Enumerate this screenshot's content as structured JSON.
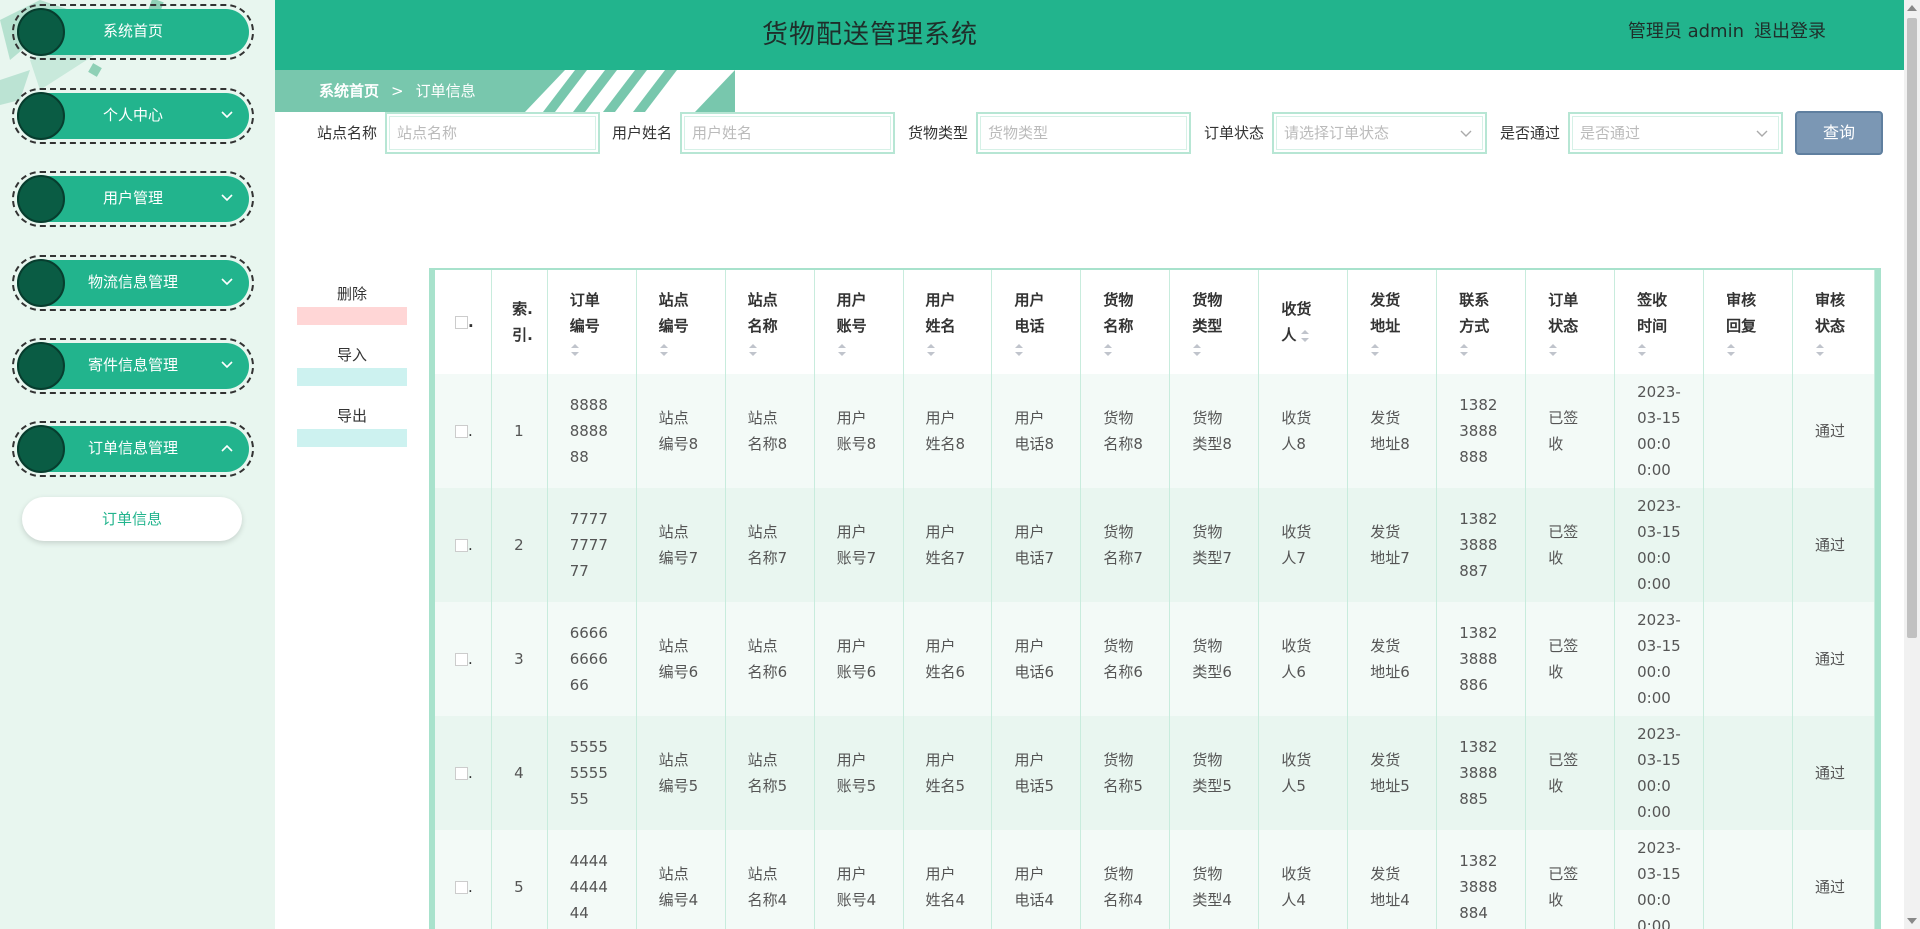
{
  "header": {
    "title": "货物配送管理系统",
    "user_label": "管理员 admin",
    "logout_label": "退出登录"
  },
  "sidebar": {
    "items": [
      {
        "label": "系统首页",
        "has_chevron": false
      },
      {
        "label": "个人中心",
        "has_chevron": true,
        "chevron": "chevron-down-icon"
      },
      {
        "label": "用户管理",
        "has_chevron": true,
        "chevron": "chevron-down-icon"
      },
      {
        "label": "物流信息管理",
        "has_chevron": true,
        "chevron": "chevron-down-icon"
      },
      {
        "label": "寄件信息管理",
        "has_chevron": true,
        "chevron": "chevron-down-icon"
      },
      {
        "label": "订单信息管理",
        "has_chevron": true,
        "chevron": "chevron-up-icon"
      }
    ],
    "sub_item": "订单信息"
  },
  "breadcrumb": {
    "home": "系统首页",
    "separator": ">",
    "current": "订单信息"
  },
  "search": {
    "fields": [
      {
        "label": "站点名称",
        "placeholder": "站点名称"
      },
      {
        "label": "用户姓名",
        "placeholder": "用户姓名"
      },
      {
        "label": "货物类型",
        "placeholder": "货物类型"
      },
      {
        "label": "订单状态",
        "placeholder": "请选择订单状态"
      },
      {
        "label": "是否通过",
        "placeholder": "是否通过"
      }
    ],
    "button": "查询"
  },
  "actions": {
    "delete": "删除",
    "import": "导入",
    "export": "导出"
  },
  "table": {
    "headers": [
      [
        "索.",
        "引."
      ],
      [
        "订单",
        "编号"
      ],
      [
        "站点",
        "编号"
      ],
      [
        "站点",
        "名称"
      ],
      [
        "用户",
        "账号"
      ],
      [
        "用户",
        "姓名"
      ],
      [
        "用户",
        "电话"
      ],
      [
        "货物",
        "名称"
      ],
      [
        "货物",
        "类型"
      ],
      [
        "收货",
        "人"
      ],
      [
        "发货",
        "地址"
      ],
      [
        "联系",
        "方式"
      ],
      [
        "订单",
        "状态"
      ],
      [
        "签收",
        "时间"
      ],
      [
        "审核",
        "回复"
      ],
      [
        "审核",
        "状态"
      ]
    ],
    "rows": [
      {
        "index": "1",
        "order_no": [
          "8888",
          "8888",
          "88"
        ],
        "site_no": [
          "站点",
          "编号8"
        ],
        "site_name": [
          "站点",
          "名称8"
        ],
        "account": [
          "用户",
          "账号8"
        ],
        "name": [
          "用户",
          "姓名8"
        ],
        "phone": [
          "用户",
          "电话8"
        ],
        "goods_name": [
          "货物",
          "名称8"
        ],
        "goods_type": [
          "货物",
          "类型8"
        ],
        "receiver": [
          "收货",
          "人8"
        ],
        "address": [
          "发货",
          "地址8"
        ],
        "contact": [
          "1382",
          "3888",
          "888"
        ],
        "status": [
          "已签",
          "收"
        ],
        "sign_time": [
          "2023-",
          "03-15",
          "00:0",
          "0:00"
        ],
        "reply": "",
        "review": "通过"
      },
      {
        "index": "2",
        "order_no": [
          "7777",
          "7777",
          "77"
        ],
        "site_no": [
          "站点",
          "编号7"
        ],
        "site_name": [
          "站点",
          "名称7"
        ],
        "account": [
          "用户",
          "账号7"
        ],
        "name": [
          "用户",
          "姓名7"
        ],
        "phone": [
          "用户",
          "电话7"
        ],
        "goods_name": [
          "货物",
          "名称7"
        ],
        "goods_type": [
          "货物",
          "类型7"
        ],
        "receiver": [
          "收货",
          "人7"
        ],
        "address": [
          "发货",
          "地址7"
        ],
        "contact": [
          "1382",
          "3888",
          "887"
        ],
        "status": [
          "已签",
          "收"
        ],
        "sign_time": [
          "2023-",
          "03-15",
          "00:0",
          "0:00"
        ],
        "reply": "",
        "review": "通过"
      },
      {
        "index": "3",
        "order_no": [
          "6666",
          "6666",
          "66"
        ],
        "site_no": [
          "站点",
          "编号6"
        ],
        "site_name": [
          "站点",
          "名称6"
        ],
        "account": [
          "用户",
          "账号6"
        ],
        "name": [
          "用户",
          "姓名6"
        ],
        "phone": [
          "用户",
          "电话6"
        ],
        "goods_name": [
          "货物",
          "名称6"
        ],
        "goods_type": [
          "货物",
          "类型6"
        ],
        "receiver": [
          "收货",
          "人6"
        ],
        "address": [
          "发货",
          "地址6"
        ],
        "contact": [
          "1382",
          "3888",
          "886"
        ],
        "status": [
          "已签",
          "收"
        ],
        "sign_time": [
          "2023-",
          "03-15",
          "00:0",
          "0:00"
        ],
        "reply": "",
        "review": "通过"
      },
      {
        "index": "4",
        "order_no": [
          "5555",
          "5555",
          "55"
        ],
        "site_no": [
          "站点",
          "编号5"
        ],
        "site_name": [
          "站点",
          "名称5"
        ],
        "account": [
          "用户",
          "账号5"
        ],
        "name": [
          "用户",
          "姓名5"
        ],
        "phone": [
          "用户",
          "电话5"
        ],
        "goods_name": [
          "货物",
          "名称5"
        ],
        "goods_type": [
          "货物",
          "类型5"
        ],
        "receiver": [
          "收货",
          "人5"
        ],
        "address": [
          "发货",
          "地址5"
        ],
        "contact": [
          "1382",
          "3888",
          "885"
        ],
        "status": [
          "已签",
          "收"
        ],
        "sign_time": [
          "2023-",
          "03-15",
          "00:0",
          "0:00"
        ],
        "reply": "",
        "review": "通过"
      },
      {
        "index": "5",
        "order_no": [
          "4444",
          "4444",
          "44"
        ],
        "site_no": [
          "站点",
          "编号4"
        ],
        "site_name": [
          "站点",
          "名称4"
        ],
        "account": [
          "用户",
          "账号4"
        ],
        "name": [
          "用户",
          "姓名4"
        ],
        "phone": [
          "用户",
          "电话4"
        ],
        "goods_name": [
          "货物",
          "名称4"
        ],
        "goods_type": [
          "货物",
          "类型4"
        ],
        "receiver": [
          "收货",
          "人4"
        ],
        "address": [
          "发货",
          "地址4"
        ],
        "contact": [
          "1382",
          "3888",
          "884"
        ],
        "status": [
          "已签",
          "收"
        ],
        "sign_time": [
          "2023-",
          "03-15",
          "00:0",
          "0:00"
        ],
        "reply": "",
        "review": "通过"
      }
    ]
  },
  "colors": {
    "primary": "#22b48d",
    "sidebar_bg": "#e8f6ef",
    "delete_bar": "#ffd6d6",
    "import_bar": "#cdf2f0",
    "query_btn": "#7b97b4"
  }
}
